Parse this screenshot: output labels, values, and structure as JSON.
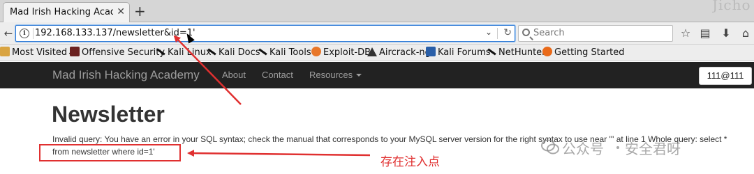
{
  "browser": {
    "tab": {
      "title": "Mad Irish Hacking Academ",
      "close": "✕"
    },
    "new_tab": "+",
    "url": "192.168.133.137/newsletter&id=1'",
    "search_placeholder": "Search"
  },
  "bookmarks": [
    {
      "label": "Most Visited",
      "icon": "folder-icon"
    },
    {
      "label": "Offensive Security",
      "icon": "offsec-icon"
    },
    {
      "label": "Kali Linux",
      "icon": "kali-dragon-icon"
    },
    {
      "label": "Kali Docs",
      "icon": "kali-dragon-icon"
    },
    {
      "label": "Kali Tools",
      "icon": "kali-dragon-icon"
    },
    {
      "label": "Exploit-DB",
      "icon": "exploitdb-icon"
    },
    {
      "label": "Aircrack-ng",
      "icon": "aircrack-icon"
    },
    {
      "label": "Kali Forums",
      "icon": "kali-forums-icon"
    },
    {
      "label": "NetHunter",
      "icon": "kali-dragon-icon"
    },
    {
      "label": "Getting Started",
      "icon": "firefox-icon"
    }
  ],
  "site": {
    "brand": "Mad Irish Hacking Academy",
    "nav": [
      "About",
      "Contact",
      "Resources"
    ],
    "user": "111@111"
  },
  "content": {
    "title": "Newsletter",
    "error_line1": "Invalid query: You have an error in your SQL syntax; check the manual that corresponds to your MySQL server version for the right syntax to use near ''' at line 1 Whole query: select *",
    "error_line2": "from newsletter where id=1'"
  },
  "annotation": {
    "text": "存在注入点",
    "color": "#e03030"
  },
  "watermark": {
    "left": "公众号",
    "right": "安全君呀"
  }
}
